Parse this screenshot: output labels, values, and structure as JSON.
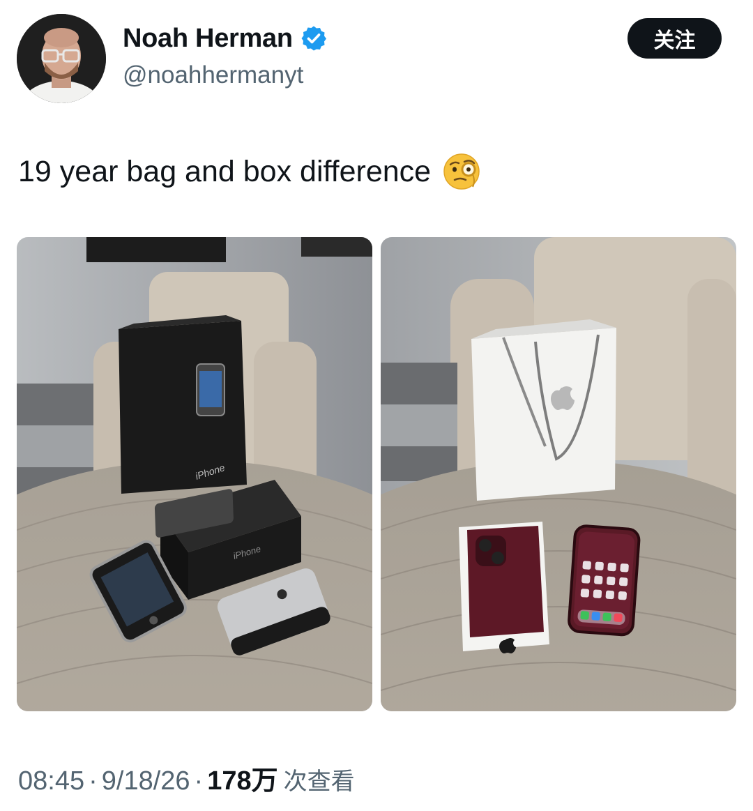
{
  "author": {
    "display_name": "Noah Herman",
    "handle": "@noahhermanyt",
    "verified_icon": "verified-badge-icon"
  },
  "follow_button": {
    "label": "关注"
  },
  "tweet": {
    "text": "19 year bag and box difference",
    "emoji": "face-with-monocle-icon"
  },
  "media": {
    "left": {
      "box_brand_text": "iPhone",
      "box_side_text": "iPhone"
    },
    "right": {}
  },
  "meta": {
    "time": "08:45",
    "date": "9/18/26",
    "separator": "·",
    "views_count": "178万",
    "views_label": "次查看"
  },
  "colors": {
    "text_primary": "#0f1419",
    "text_secondary": "#536471",
    "verified_blue": "#1d9bf0",
    "button_bg": "#0f1419"
  }
}
